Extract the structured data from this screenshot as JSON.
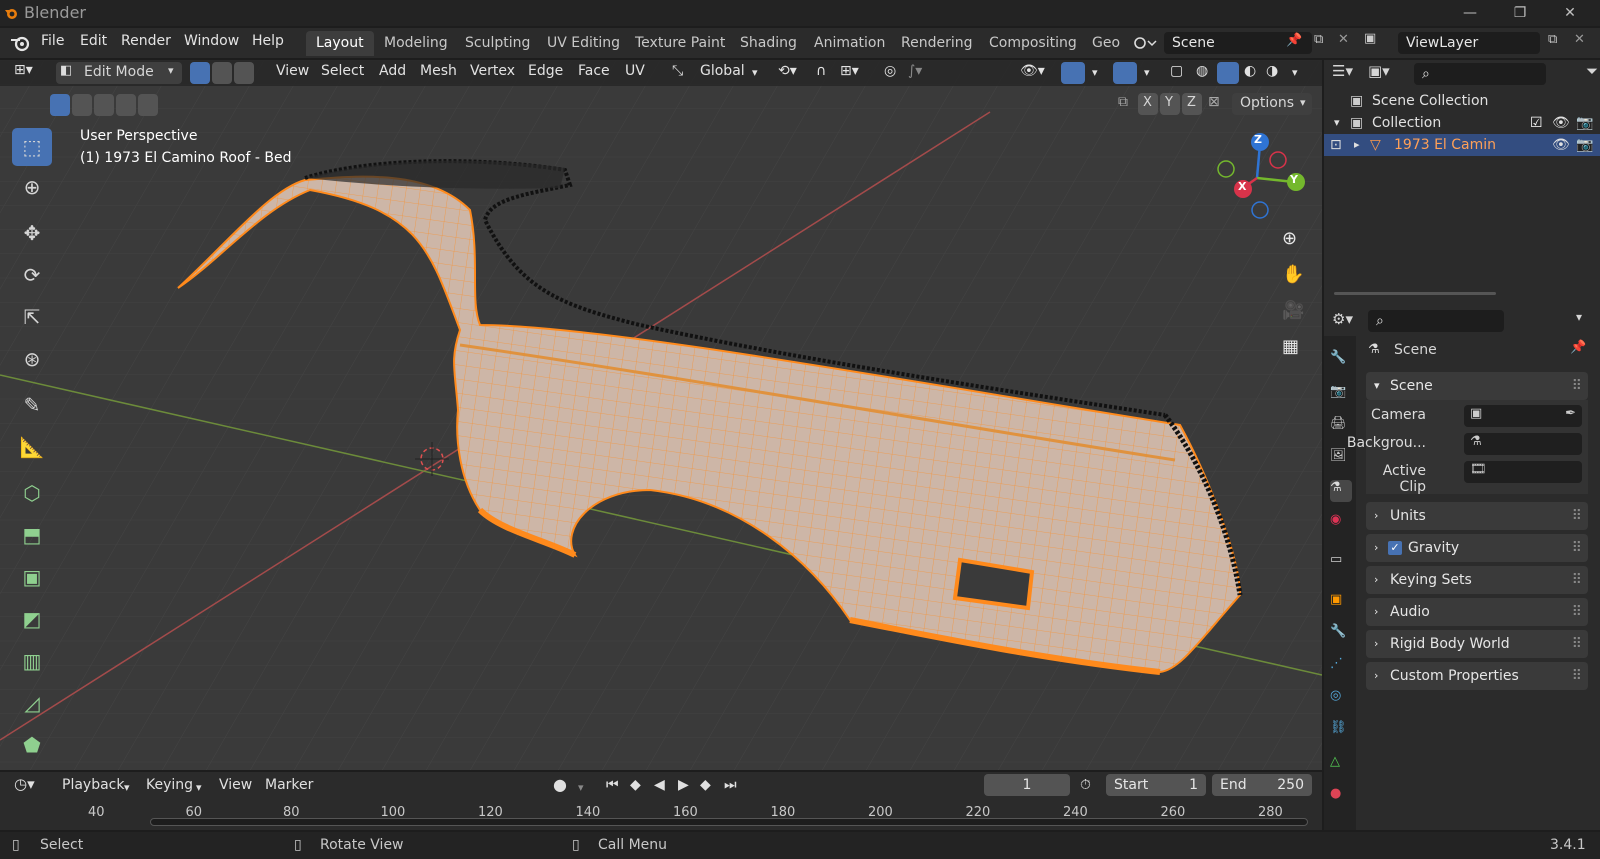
{
  "app": {
    "title": "Blender",
    "version": "3.4.1"
  },
  "menubar": {
    "menus": [
      "File",
      "Edit",
      "Render",
      "Window",
      "Help"
    ],
    "workspaces": [
      "Layout",
      "Modeling",
      "Sculpting",
      "UV Editing",
      "Texture Paint",
      "Shading",
      "Animation",
      "Rendering",
      "Compositing",
      "Geo"
    ],
    "active_workspace": "Layout",
    "scene": "Scene",
    "view_layer": "ViewLayer"
  },
  "viewport_header": {
    "mode": "Edit Mode",
    "menus": [
      "View",
      "Select",
      "Add",
      "Mesh",
      "Vertex",
      "Edge",
      "Face",
      "UV"
    ],
    "transform_orientation": "Global",
    "axes": [
      "X",
      "Y",
      "Z"
    ],
    "options_label": "Options"
  },
  "viewport": {
    "perspective_label": "User Perspective",
    "object_label": "(1) 1973 El Camino Roof - Bed",
    "gizmo_axes": {
      "z": "Z",
      "y": "Y",
      "x": "X"
    },
    "colors": {
      "background": "#3a3a3a",
      "mesh_face": "#c9b4a6",
      "selected_edge": "#ff8a1c",
      "unselected": "#000000"
    }
  },
  "outliner": {
    "scene_collection": "Scene Collection",
    "collection": "Collection",
    "object": "1973 El Camin"
  },
  "properties": {
    "context": "Scene",
    "panel_title": "Scene",
    "camera_label": "Camera",
    "background_label": "Backgrou...",
    "active_clip_label": "Active Clip",
    "subpanels": [
      "Units",
      "Gravity",
      "Keying Sets",
      "Audio",
      "Rigid Body World",
      "Custom Properties"
    ]
  },
  "timeline": {
    "menus": [
      "Playback",
      "Keying",
      "View",
      "Marker"
    ],
    "current_frame": "1",
    "start_label": "Start",
    "start": "1",
    "end_label": "End",
    "end": "250",
    "ticks": [
      "40",
      "60",
      "80",
      "100",
      "120",
      "140",
      "160",
      "180",
      "200",
      "220",
      "240",
      "260",
      "280"
    ]
  },
  "statusbar": {
    "select": "Select",
    "rotate": "Rotate View",
    "menu": "Call Menu"
  }
}
